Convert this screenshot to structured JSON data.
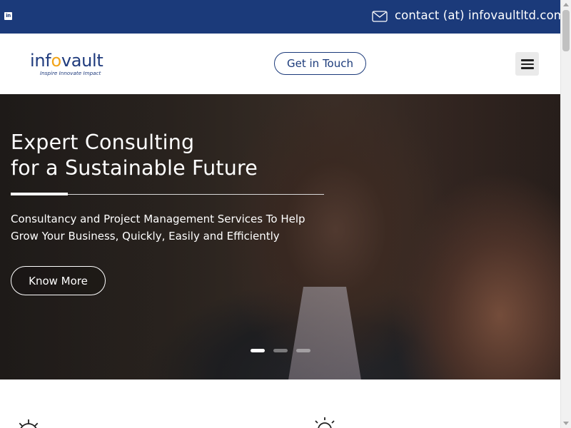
{
  "topbar": {
    "linkedin_icon": "linkedin-icon",
    "mail_icon": "envelope-icon",
    "contact_text": "contact (at) infovaultltd.com",
    "background_color": "#1b3a7a"
  },
  "header": {
    "logo": {
      "word_part1": "inf",
      "word_part2": "o",
      "word_part3": "vault",
      "tagline": "Inspire Innovate Impact",
      "brand_blue": "#1f3b7d",
      "brand_orange": "#f2a418"
    },
    "cta_label": "Get in Touch",
    "menu_icon": "hamburger-menu-icon"
  },
  "hero": {
    "title_line1": "Expert Consulting",
    "title_line2": "for a Sustainable Future",
    "subtitle_line1": "Consultancy and Project Management Services To Help",
    "subtitle_line2": "Grow Your Business, Quickly, Easily and Efficiently",
    "button_label": "Know More",
    "slides_total": 3,
    "active_slide": 1
  },
  "features": {
    "icons": [
      "gear-icon",
      "lightbulb-icon"
    ]
  }
}
